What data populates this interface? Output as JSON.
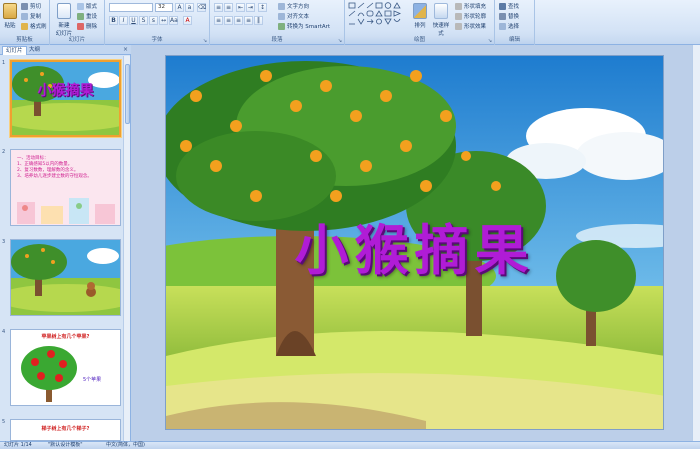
{
  "ribbon": {
    "clipboard": {
      "label": "剪贴板",
      "paste": "粘贴",
      "cut": "剪切",
      "copy": "复制",
      "format_painter": "格式刷"
    },
    "slides": {
      "label": "幻灯片",
      "new_slide": "新建",
      "new_slide_line2": "幻灯片",
      "layout": "版式",
      "reset": "重设",
      "delete": "删除"
    },
    "font": {
      "label": "字体",
      "font_name": "",
      "font_size": "32"
    },
    "paragraph": {
      "label": "段落",
      "text_direction": "文字方向",
      "align_text": "对齐文本",
      "convert_smartart": "转换为 SmartArt"
    },
    "drawing": {
      "label": "绘图",
      "arrange": "排列",
      "quick_styles": "快速样式",
      "shape_fill": "形状填充",
      "shape_outline": "形状轮廓",
      "shape_effects": "形状效果"
    },
    "editing": {
      "label": "编辑",
      "find": "查找",
      "replace": "替换",
      "select": "选择"
    }
  },
  "panel": {
    "tab_slides": "幻灯片",
    "tab_outline": "大纲",
    "close": "×",
    "thumbnails": [
      {
        "number": "1",
        "title": "小猴摘果"
      },
      {
        "number": "2",
        "text_title": "一、活动目标：",
        "lines": [
          "1、正确感知5以内的数量。",
          "2、复习数数，理解数的含义。",
          "3、培养幼儿逐步建立数的守恒观念。"
        ]
      },
      {
        "number": "3"
      },
      {
        "number": "4",
        "question": "苹果树上有几个苹果?",
        "answer": "5个苹果"
      },
      {
        "number": "5",
        "question": "梯子树上有几个梯子?"
      }
    ]
  },
  "slide": {
    "title": "小猴摘果"
  },
  "status": {
    "slide_counter": "幻灯片 1/14",
    "theme": "\"默认设计模板\"",
    "language": "中文(简体，中国)"
  },
  "colors": {
    "ribbon_bg": "#d4e3f6",
    "title_purple": "#b01cd6",
    "selection_orange": "#f0a030"
  }
}
